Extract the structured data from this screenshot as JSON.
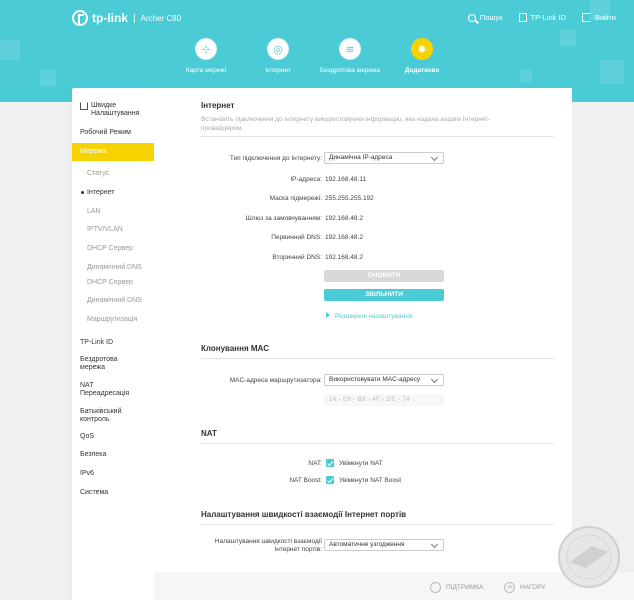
{
  "brand": {
    "logo": "tp-link",
    "model": "Archer C80"
  },
  "top_links": {
    "search": "Пошук",
    "tplink_id": "TP-Link ID",
    "logout": "Вийти"
  },
  "nav_tabs": [
    {
      "label": "Карта мережі",
      "icon": "network-map-icon"
    },
    {
      "label": "Інтернет",
      "icon": "globe-icon"
    },
    {
      "label": "Бездротова мережа",
      "icon": "wifi-icon"
    },
    {
      "label": "Додатково",
      "icon": "gear-icon"
    }
  ],
  "sidebar": {
    "quick_setup": "Швидке Налаштування",
    "operation_mode": "Робочий Режим",
    "network": "Мережа",
    "sub": [
      "Статус",
      "Інтернет",
      "LAN",
      "IPTV/VLAN",
      "DHCP Сервер",
      "Динамічний DNS",
      "DHCP Сервер",
      "Динамічний DNS",
      "Маршрутизація"
    ],
    "items": [
      "TP-Link ID",
      "Бездротова мережа",
      "NAT Переадресація",
      "Батьківський контроль",
      "QoS",
      "Безпека",
      "IPv6",
      "Система"
    ]
  },
  "internet": {
    "title": "Інтернет",
    "desc": "Встановіть підключення до Інтернету використовуючи інформацію, яка надана вашим Інтернет-провайдером.",
    "conn_type_label": "Тип підключення до Інтернету:",
    "conn_type_value": "Динамічна IP-адреса",
    "ip_label": "IP-адреса:",
    "ip_value": "192.168.48.11",
    "mask_label": "Маска підмережі:",
    "mask_value": "255.255.255.192",
    "gw_label": "Шлюз за замовчуванням:",
    "gw_value": "192.168.48.2",
    "dns1_label": "Первинний DNS:",
    "dns1_value": "192.168.48.2",
    "dns2_label": "Вторинний DNS:",
    "dns2_value": "192.168.48.2",
    "renew": "ОНОВИТИ",
    "release": "ЗВІЛЬНИТИ",
    "advanced": "Розширені налаштування"
  },
  "mac_clone": {
    "title": "Клонування MAC",
    "label": "MAC-адреса маршрутизатора:",
    "value": "Використовувати MAC-адресу",
    "mac": "14 - E8 - B8 - 4F - DE - 74"
  },
  "nat": {
    "title": "NAT",
    "nat_label": "NAT:",
    "nat_value": "Увімкнути NAT",
    "boost_label": "NAT Boost:",
    "boost_value": "Увімкнути NAT Boost"
  },
  "port_speed": {
    "title": "Налаштування швидкості взаємодії Інтернет портів",
    "label": "Налаштування швидкості взаємодії Інтернет портів:",
    "value": "Автоматичне узгодження"
  },
  "footer": {
    "support": "ПІДТРИМКА",
    "top": "НАГОРУ"
  },
  "colors": {
    "accent": "#4acbd6",
    "active": "#f6d200"
  }
}
